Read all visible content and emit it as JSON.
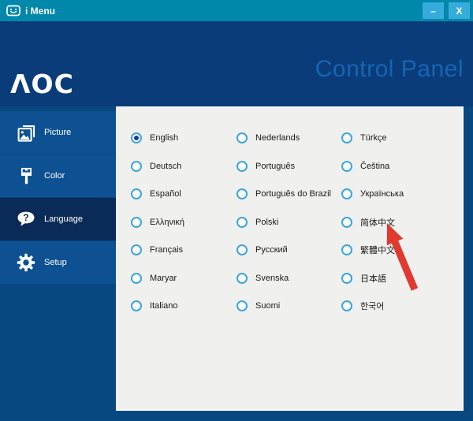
{
  "window": {
    "title": "i Menu"
  },
  "titlebar": {
    "app_icon": "smiley-monitor-icon",
    "minimize_label": "–",
    "close_label": "X"
  },
  "header": {
    "logo_text": "ΛOC",
    "title": "Control Panel"
  },
  "sidebar": {
    "items": [
      {
        "label": "Picture",
        "icon": "picture-icon",
        "selected": false
      },
      {
        "label": "Color",
        "icon": "brush-icon",
        "selected": false
      },
      {
        "label": "Language",
        "icon": "speech-bubble-question-icon",
        "selected": true
      },
      {
        "label": "Setup",
        "icon": "gear-icon",
        "selected": false
      }
    ]
  },
  "languages": {
    "selected": "English",
    "columns": [
      [
        "English",
        "Deutsch",
        "Español",
        "Ελληνική",
        "Français",
        "Maryar",
        "Italiano"
      ],
      [
        "Nederlands",
        "Português",
        "Português do Brazil",
        "Polski",
        "Русский",
        "Svenska",
        "Suomi"
      ],
      [
        "Türkçe",
        "Čeština",
        "Українська",
        "简体中文",
        "繁體中文",
        "日本語",
        "한국어"
      ]
    ],
    "arrow_points_to": "简体中文"
  },
  "colors": {
    "titlebar": "#0088AB",
    "window_button": "#36ACDC",
    "header": "#0A3C7A",
    "header_title_text": "#1565B4",
    "sidebar_item": "#0E5192",
    "sidebar_selected": "#0A2A57",
    "window_background": "#06487F",
    "panel_background": "#F0F0EF",
    "radio_ring": "#3AA7D9",
    "radio_dot": "#26319E",
    "arrow_red": "#E0392E"
  }
}
